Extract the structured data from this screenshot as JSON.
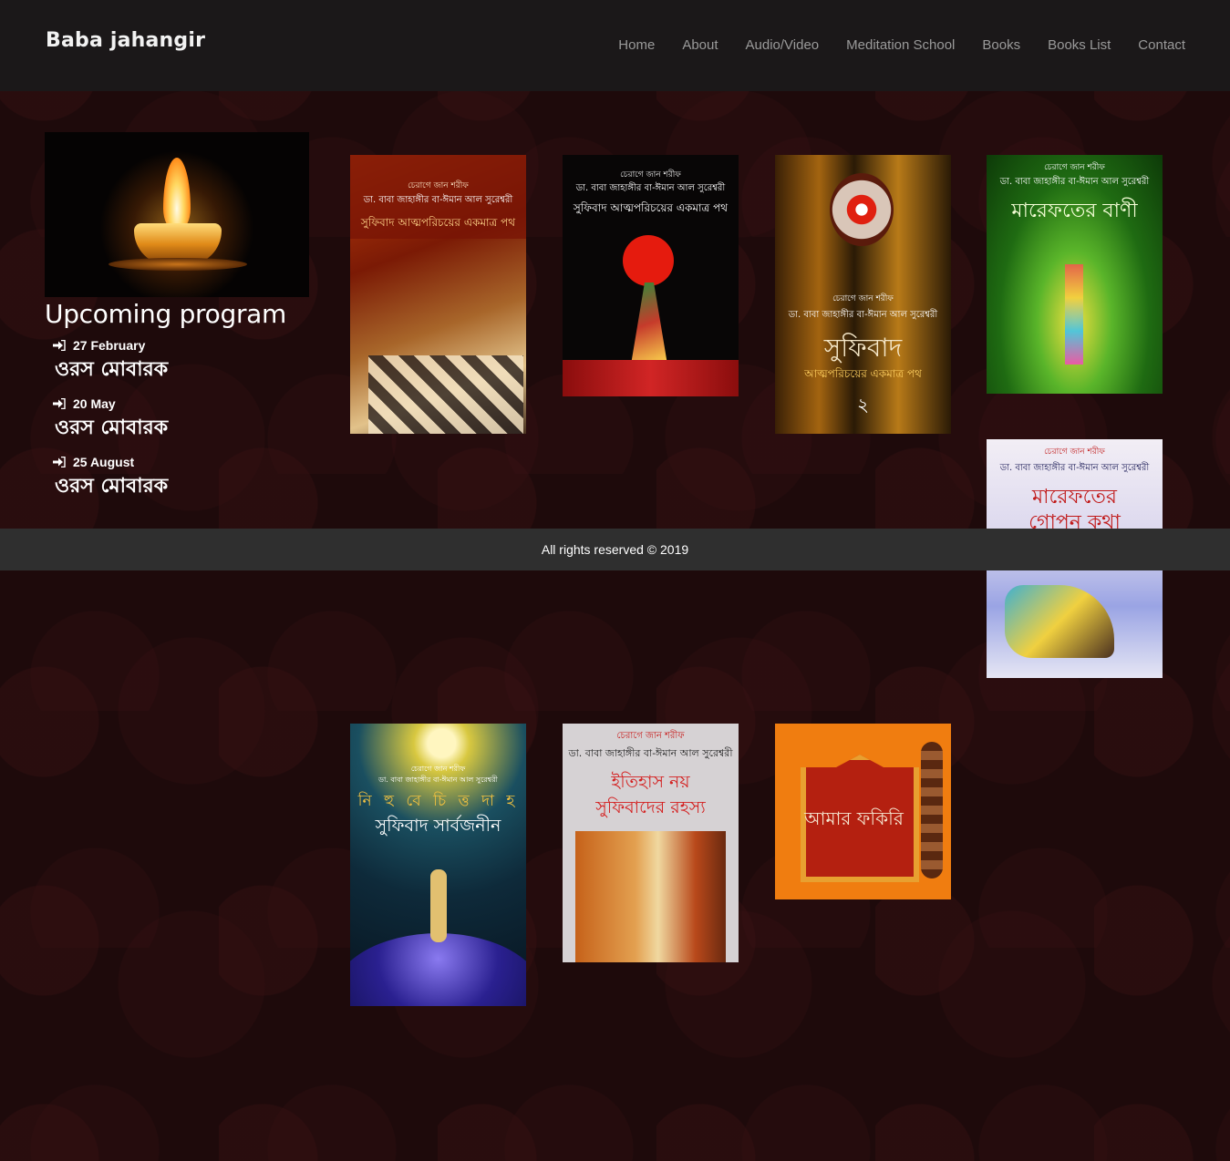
{
  "header": {
    "logo": "Baba jahangir",
    "nav": [
      "Home",
      "About",
      "Audio/Video",
      "Meditation School",
      "Books",
      "Books List",
      "Contact"
    ]
  },
  "sidebar": {
    "image": "candle",
    "title": "Upcoming program",
    "programs": [
      {
        "date": "27 February",
        "name": "ওরস মোবারক"
      },
      {
        "date": "20 May",
        "name": "ওরস মোবারক"
      },
      {
        "date": "25 August",
        "name": "ওরস মোবারক"
      }
    ]
  },
  "books": [
    {
      "line1": "চেরাগে জান শরীফ",
      "line2": "ডা. বাবা জাহাঙ্গীর বা-ঈমান আল সুরেশ্বরী",
      "line3": "সুফিবাদ আত্মপরিচয়ের একমাত্র পথ"
    },
    {
      "line1": "চেরাগে জান শরীফ",
      "line2": "ডা. বাবা জাহাঙ্গীর বা-ঈমান আল সুরেশ্বরী",
      "line3": "সুফিবাদ আত্মপরিচয়ের একমাত্র পথ"
    },
    {
      "line1": "চেরাগে জান শরীফ",
      "line2": "ডা. বাবা জাহাঙ্গীর বা-ঈমান আল সুরেশ্বরী",
      "line3": "সুফিবাদ"
    },
    {
      "line1": "চেরাগে জান শরীফ",
      "line2": "ডা. বাবা জাহাঙ্গীর বা-ঈমান আল সুরেশ্বরী",
      "line3": "মারেফতের বাণী"
    },
    {
      "line1": "চেরাগে জান শরীফ",
      "line2": "ডা. বাবা জাহাঙ্গীর বা-ঈমান আল সুরেশ্বরী",
      "line3": "মারেফতের গোপন কথা"
    },
    {
      "line1": "চেরাগে জান শরীফ",
      "line2": "ডা. বাবা জাহাঙ্গীর বা-ঈমান আল সুরেশ্বরী",
      "line3": "সুফিবাদ সার্বজনীন"
    },
    {
      "line1": "চেরাগে জান শরীফ",
      "line2": "ডা. বাবা জাহাঙ্গীর বা-ঈমান আল সুরেশ্বরী",
      "line3": "ইতিহাস নয় সুফিবাদের রহস্য"
    },
    {
      "line1": "",
      "line2": "",
      "line3": "আমার ফকিরি"
    }
  ],
  "footer": {
    "text": "All rights reserved © 2019"
  }
}
